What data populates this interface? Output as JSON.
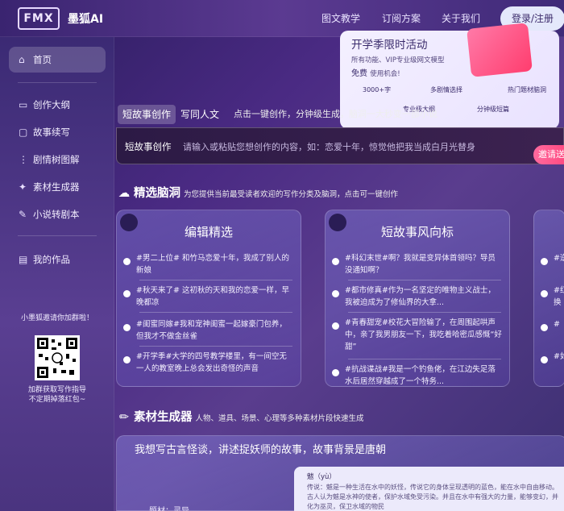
{
  "header": {
    "logo_text": "FMX",
    "brand": "墨狐AI",
    "nav": [
      "图文教学",
      "订阅方案",
      "关于我们"
    ],
    "login": "登录/注册"
  },
  "sidebar": {
    "items": [
      {
        "label": "首页",
        "icon": "home-icon"
      },
      {
        "label": "创作大纲",
        "icon": "document-icon"
      },
      {
        "label": "故事续写",
        "icon": "folder-icon"
      },
      {
        "label": "剧情树图解",
        "icon": "tree-icon"
      },
      {
        "label": "素材生成器",
        "icon": "sparkle-icon"
      },
      {
        "label": "小说转剧本",
        "icon": "pen-icon"
      },
      {
        "label": "我的作品",
        "icon": "book-icon"
      }
    ],
    "qr_title": "小墨狐邀请你加群啦！",
    "qr_sub1": "加群获取写作指导",
    "qr_sub2": "不定期掉落红包~"
  },
  "promo": {
    "title": "开学季限时活动",
    "desc": "所有功能、VIP专业级网文模型",
    "free": "免费",
    "free_sub": "使用机会!",
    "features": [
      "3000+字",
      "多剧情选择",
      "热门题材脑洞",
      "专业级大纲",
      "分钟级短篇"
    ]
  },
  "tabs": {
    "items": [
      "短故事创作",
      "写同人文"
    ],
    "hint": "点击一键创作，分钟级生成，脑洞一大秒变一部小说"
  },
  "input": {
    "label": "短故事创作",
    "placeholder": "请输入或粘贴您想创作的内容，如：恋爱十年，惊觉他把我当成白月光替身",
    "submit": "邀请送"
  },
  "brainstorm": {
    "title": "精选脑洞",
    "subtitle": "为您提供当前最受读者欢迎的写作分类及脑洞，点击可一键创作",
    "cards": [
      {
        "title": "编辑精选",
        "items": [
          "#男二上位# 和竹马恋爱十年，我成了别人的新娘",
          "#秋天来了# 这初秋的天和我的恋爱一样，早晚都凉",
          "#闺蜜同嫁#我和宠神闺蜜一起嫁豪门包养，但我才不做金丝雀",
          "#开学季#大学的四号教学楼里，有一间空无一人的教室晚上总会发出奇怪的声音"
        ]
      },
      {
        "title": "短故事风向标",
        "items": [
          "#科幻末世#啊？我就是变异体首领吗？导员没通知啊？",
          "#都市修真#作为一名坚定的唯物主义战士，我被迫成为了修仙界的大拿...",
          "#青春甜宠#校花大冒险输了，在周围起哄声中，亲了我男朋友一下，我吃着哈密瓜感慨“好甜”",
          "#抗战谍战#我是一个钓鱼佬，在江边失足落水后居然穿越成了一个特务..."
        ]
      },
      {
        "title": "",
        "items": [
          "#逆",
          "#红 换",
          "#",
          "#如"
        ]
      }
    ]
  },
  "generator": {
    "title": "素材生成器",
    "subtitle": "人物、道具、场景、心理等多种素材片段快速生成",
    "prompt": "我想写古言怪谈，讲述捉妖师的故事，故事背景是唐朝",
    "entry_title": "魃（yù）",
    "entry_body": "传说：魃是一种生活在水中的妖怪，传说它的身体呈现透明的蓝色，能在水中自由移动。古人认为魃是水神的使者，保护水域免受污染。并且在水中有强大的力量，能够变幻，并化为巫灵，保卫水域的物民",
    "topic": "题材：灵异"
  }
}
